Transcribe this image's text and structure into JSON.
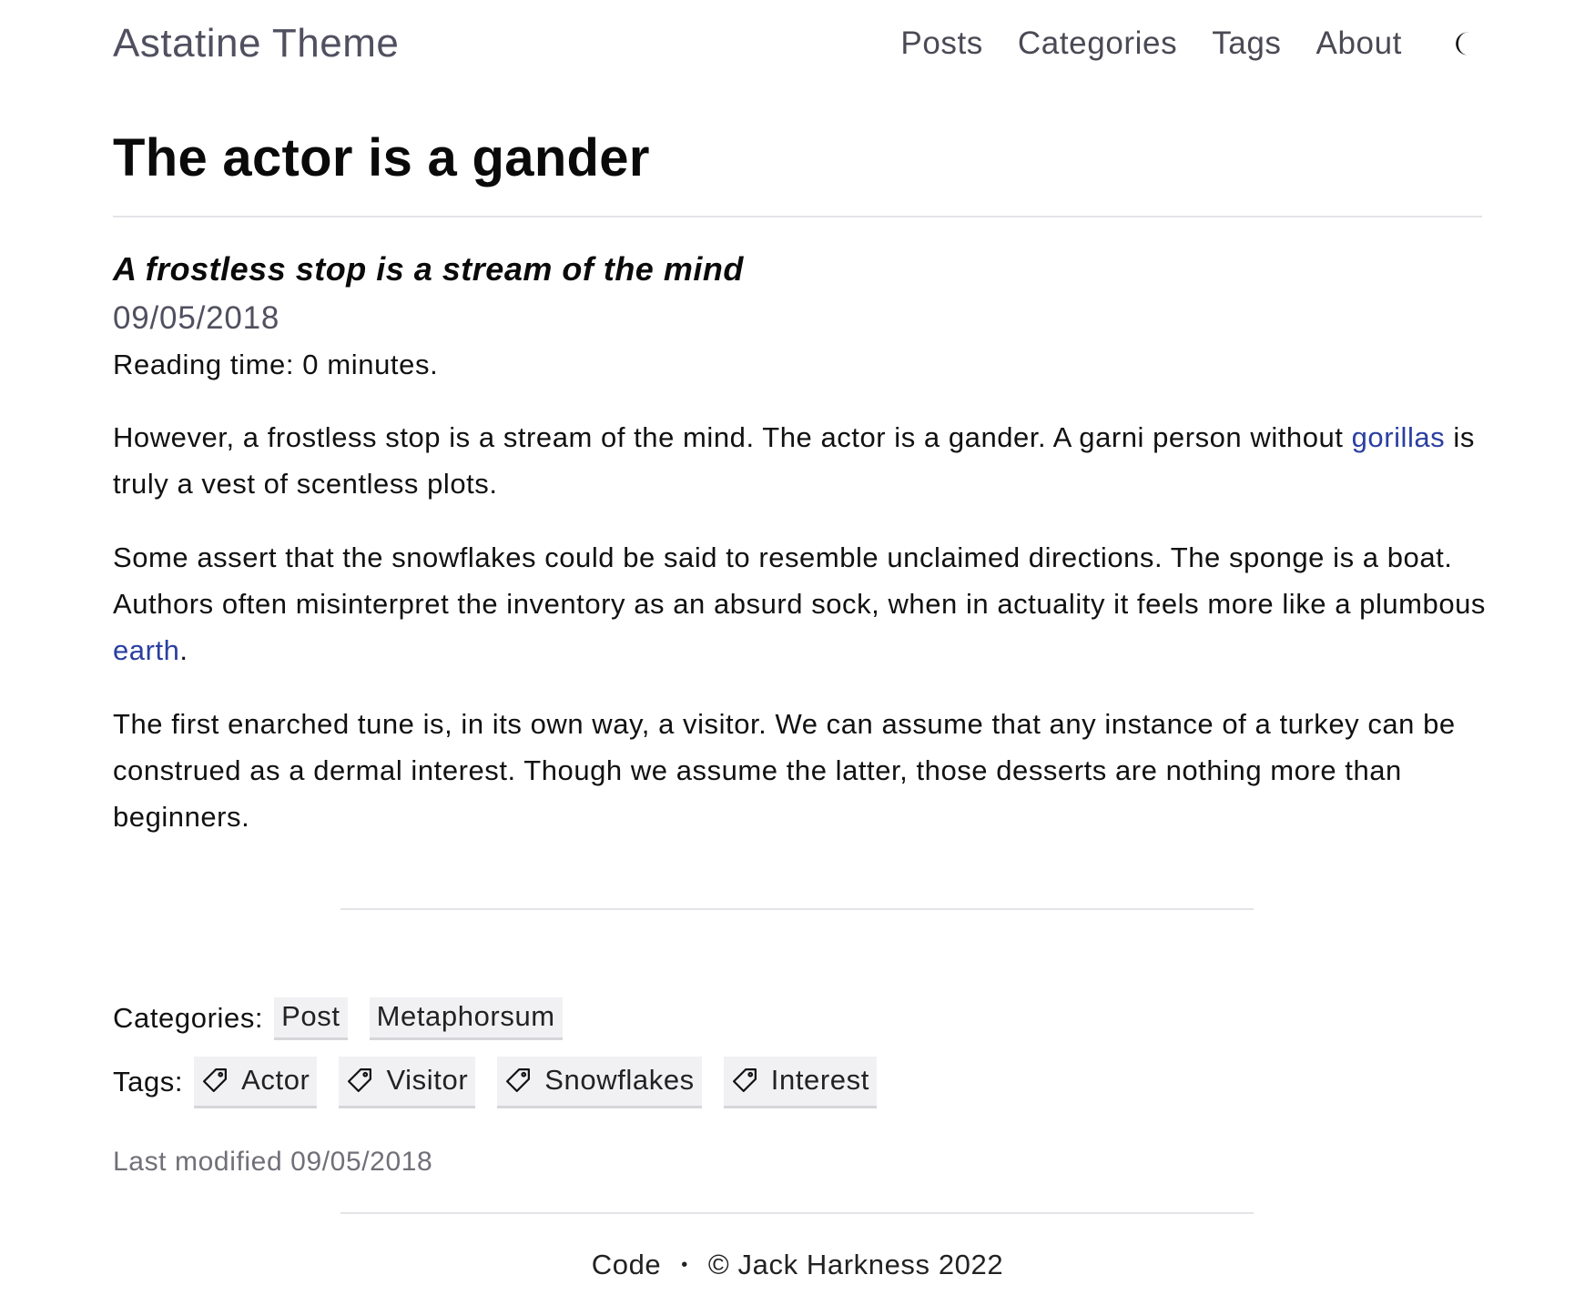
{
  "header": {
    "site_title": "Astatine Theme",
    "nav": [
      {
        "label": "Posts"
      },
      {
        "label": "Categories"
      },
      {
        "label": "Tags"
      },
      {
        "label": "About"
      }
    ],
    "theme_toggle_icon": "moon-icon"
  },
  "post": {
    "title": "The actor is a gander",
    "subtitle": "A frostless stop is a stream of the mind",
    "date": "09/05/2018",
    "reading_time": "Reading time: 0 minutes.",
    "paragraphs": [
      {
        "before": "However, a frostless stop is a stream of the mind. The actor is a gander. A garni person without ",
        "link": "gorillas",
        "after": " is truly a vest of scentless plots."
      },
      {
        "before": "Some assert that the snowflakes could be said to resemble unclaimed directions. The sponge is a boat. Authors often misinterpret the inventory as an absurd sock, when in actuality it feels more like a plumbous ",
        "link": "earth",
        "after": "."
      },
      {
        "text": "The first enarched tune is, in its own way, a visitor. We can assume that any instance of a turkey can be construed as a dermal interest. Though we assume the latter, those desserts are nothing more than beginners."
      }
    ],
    "categories_label": "Categories:",
    "categories": [
      "Post",
      "Metaphorsum"
    ],
    "tags_label": "Tags:",
    "tags": [
      "Actor",
      "Visitor",
      "Snowflakes",
      "Interest"
    ],
    "tag_icon": "tag-icon",
    "last_modified": "Last modified 09/05/2018"
  },
  "footer": {
    "code_link": "Code",
    "separator": "•",
    "copyright": "© Jack Harkness 2022"
  },
  "colors": {
    "link": "#2a3fa0",
    "muted": "#505060",
    "chip_bg": "#f1f1f3"
  }
}
